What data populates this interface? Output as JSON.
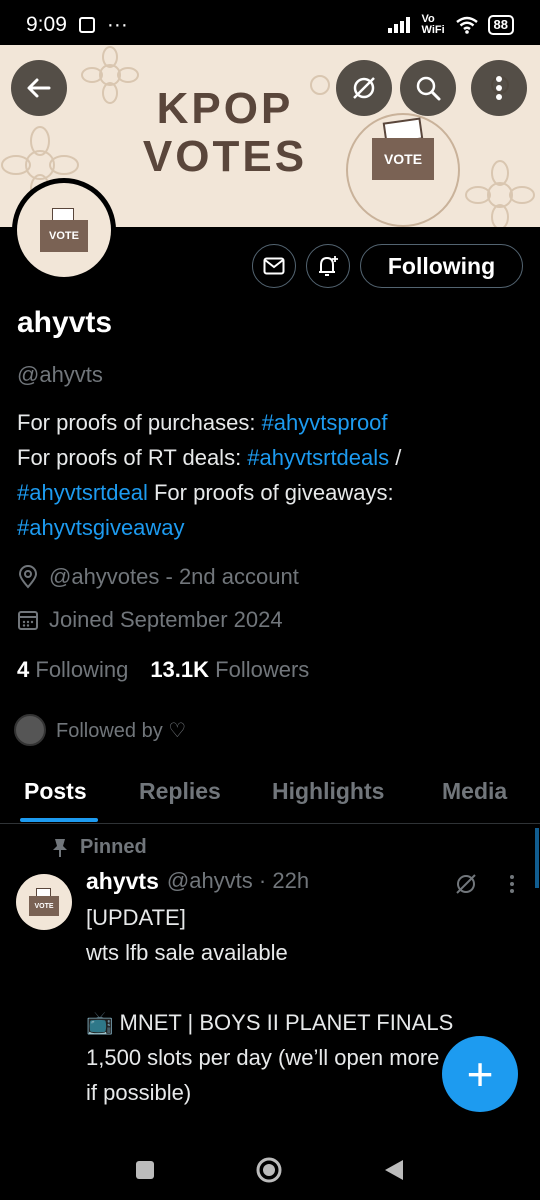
{
  "status_bar": {
    "time": "9:09",
    "more": "···",
    "network": "Vo WiFi",
    "battery": "88"
  },
  "banner": {
    "title_line1": "KPOP",
    "title_line2": "VOTES",
    "box_label": "VOTE"
  },
  "avatar": {
    "box_label": "VOTE"
  },
  "profile": {
    "follow_button": "Following",
    "name": "ahyvts",
    "handle": "@ahyvts",
    "bio_text1": "For proofs of purchases: ",
    "bio_tag1": "#ahyvtsproof",
    "bio_text2": "For proofs of RT deals: ",
    "bio_tag2": "#ahyvtsrtdeals",
    "bio_sep": " / ",
    "bio_tag3": "#ahyvtsrtdeal",
    "bio_text3": " For proofs of giveaways: ",
    "bio_tag4": "#ahyvtsgiveaway",
    "location": "@ahyvotes - 2nd account",
    "joined": "Joined September 2024",
    "following_count": "4",
    "following_label": "Following",
    "followers_count": "13.1K",
    "followers_label": "Followers",
    "followed_by": "Followed by ♡"
  },
  "tabs": [
    "Posts",
    "Replies",
    "Highlights",
    "Media"
  ],
  "post": {
    "pinned_label": "Pinned",
    "author": "ahyvts",
    "handle_time": "@ahyvts · 22h",
    "body": "[UPDATE]\nwts lfb sale available\n\n📺 MNET | BOYS II PLANET FINALS\n1,500 slots per day (we’ll open more\nif possible)",
    "avatar_label": "VOTE"
  },
  "fab": {
    "label": "+"
  },
  "colors": {
    "accent": "#1d9bf0",
    "banner_bg": "#f2e6d8",
    "banner_text": "#5a463b"
  }
}
